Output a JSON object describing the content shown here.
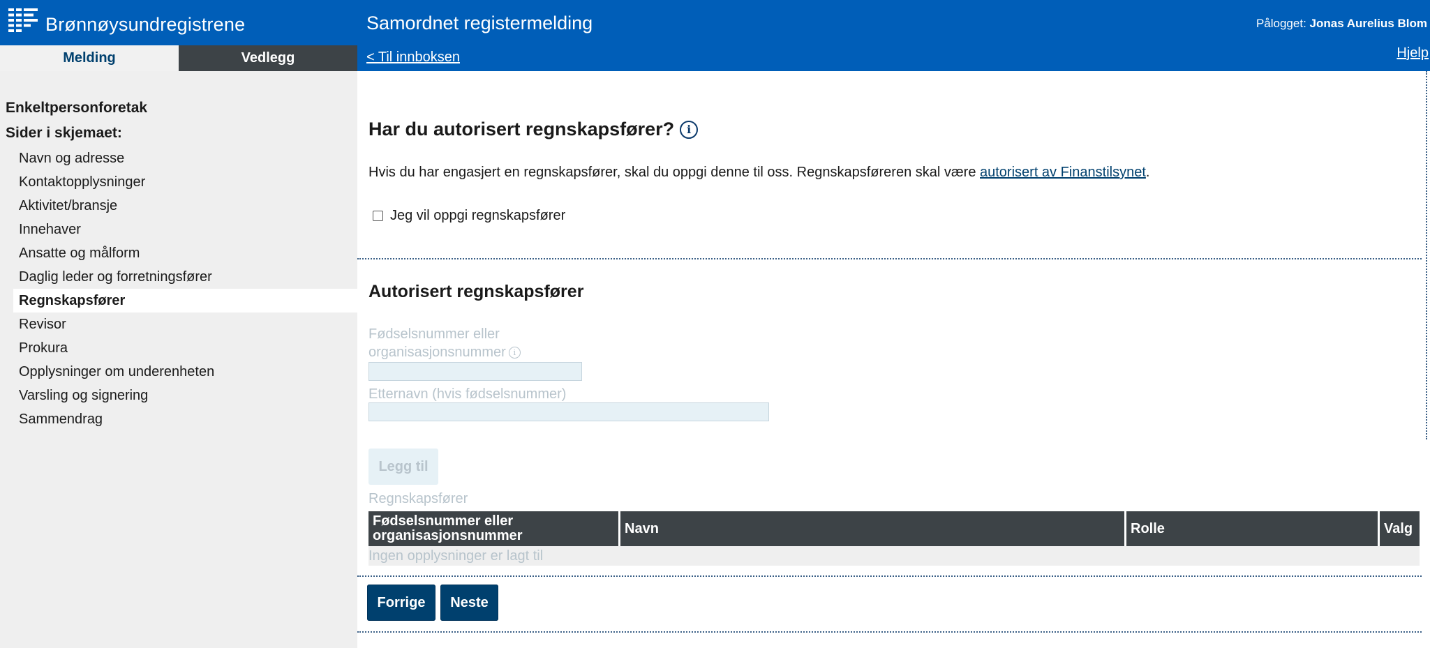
{
  "header": {
    "brand": "Brønnøysundregistrene",
    "app_title": "Samordnet registermelding",
    "logged_in_label": "Pålogget:",
    "logged_in_user": "Jonas Aurelius Blom",
    "back_link": "< Til innboksen",
    "help_link": "Hjelp",
    "colors": {
      "primary": "#005eb8",
      "dark": "#3d4347",
      "button": "#00406e"
    }
  },
  "tabs": [
    {
      "label": "Melding",
      "active": true
    },
    {
      "label": "Vedlegg",
      "active": false
    }
  ],
  "sidebar": {
    "org_type": "Enkeltpersonforetak",
    "pages_label": "Sider i skjemaet:",
    "items": [
      {
        "label": "Navn og adresse"
      },
      {
        "label": "Kontaktopplysninger"
      },
      {
        "label": "Aktivitet/bransje"
      },
      {
        "label": "Innehaver"
      },
      {
        "label": "Ansatte og målform"
      },
      {
        "label": "Daglig leder og forretningsfører"
      },
      {
        "label": "Regnskapsfører",
        "active": true
      },
      {
        "label": "Revisor"
      },
      {
        "label": "Prokura"
      },
      {
        "label": "Opplysninger om underenheten"
      },
      {
        "label": "Varsling og signering"
      },
      {
        "label": "Sammendrag"
      }
    ]
  },
  "question": {
    "title": "Har du autorisert regnskapsfører?",
    "info_icon": "info-icon",
    "description_before": "Hvis du har engasjert en regnskapsfører, skal du oppgi denne til oss. Regnskapsføreren skal være ",
    "description_link": "autorisert av Finanstilsynet",
    "description_after": ".",
    "checkbox_label": "Jeg vil oppgi regnskapsfører",
    "checkbox_checked": false
  },
  "section": {
    "title": "Autorisert regnskapsfører",
    "id_label_line1": "Fødselsnummer eller",
    "id_label_line2": "organisasjonsnummer",
    "id_value": "",
    "lastname_label": "Etternavn (hvis fødselsnummer)",
    "lastname_value": "",
    "add_button": "Legg til",
    "table_caption": "Regnskapsfører",
    "table_headers": {
      "id_line1": "Fødselsnummer eller",
      "id_line2": "organisasjonsnummer",
      "name": "Navn",
      "role": "Rolle",
      "options": "Valg"
    },
    "empty_text": "Ingen opplysninger er lagt til"
  },
  "nav_buttons": {
    "previous": "Forrige",
    "next": "Neste"
  }
}
